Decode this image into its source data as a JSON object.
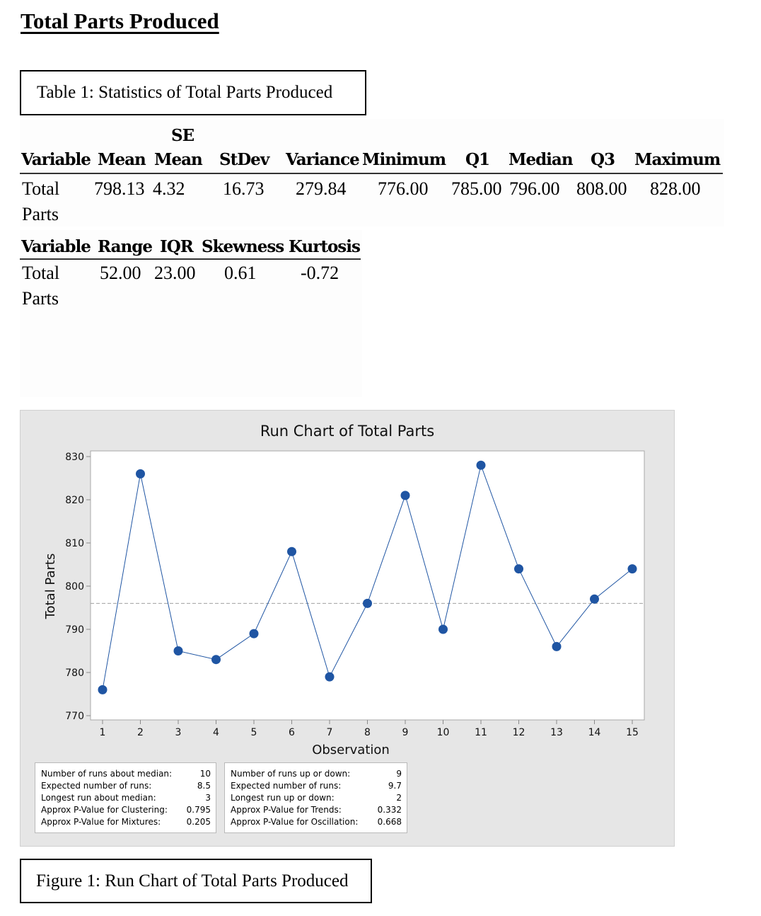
{
  "document": {
    "title": "Total Parts Produced",
    "table_caption": "Table 1: Statistics of Total Parts Produced",
    "figure_caption": "Figure 1: Run Chart of Total Parts Produced"
  },
  "stats_table_1": {
    "headers": [
      "Variable",
      "Mean",
      "SE Mean",
      "StDev",
      "Variance",
      "Minimum",
      "Q1",
      "Median",
      "Q3",
      "Maximum"
    ],
    "header_se_top": "SE",
    "header_se_bottom": "Mean",
    "row": {
      "variable_line1": "Total",
      "variable_line2": "Parts",
      "values": [
        "798.13",
        "4.32",
        "16.73",
        "279.84",
        "776.00",
        "785.00",
        "796.00",
        "808.00",
        "828.00"
      ]
    }
  },
  "stats_table_2": {
    "headers": [
      "Variable",
      "Range",
      "IQR",
      "Skewness",
      "Kurtosis"
    ],
    "row": {
      "variable_line1": "Total",
      "variable_line2": "Parts",
      "values": [
        "52.00",
        "23.00",
        "0.61",
        "-0.72"
      ]
    }
  },
  "chart_data": {
    "type": "line",
    "title": "Run Chart of Total Parts",
    "xlabel": "Observation",
    "ylabel": "Total Parts",
    "x": [
      1,
      2,
      3,
      4,
      5,
      6,
      7,
      8,
      9,
      10,
      11,
      12,
      13,
      14,
      15
    ],
    "values": [
      776,
      826,
      785,
      783,
      789,
      808,
      779,
      796,
      821,
      790,
      828,
      804,
      786,
      797,
      804
    ],
    "median_line": 796,
    "ylim": [
      770,
      830
    ],
    "xlim": [
      1,
      15
    ],
    "yticks": [
      770,
      780,
      790,
      800,
      810,
      820,
      830
    ],
    "xticks": [
      1,
      2,
      3,
      4,
      5,
      6,
      7,
      8,
      9,
      10,
      11,
      12,
      13,
      14,
      15
    ],
    "grid": false,
    "series_color": "#1f55a3",
    "median_line_color": "#a0a0a0",
    "runs_median": [
      {
        "label": "Number of runs about median:",
        "value": "10"
      },
      {
        "label": "Expected number of runs:",
        "value": "8.5"
      },
      {
        "label": "Longest run about median:",
        "value": "3"
      },
      {
        "label": "Approx P-Value for Clustering:",
        "value": "0.795"
      },
      {
        "label": "Approx P-Value for Mixtures:",
        "value": "0.205"
      }
    ],
    "runs_updown": [
      {
        "label": "Number of runs up or down:",
        "value": "9"
      },
      {
        "label": "Expected number of runs:",
        "value": "9.7"
      },
      {
        "label": "Longest run up or down:",
        "value": "2"
      },
      {
        "label": "Approx P-Value for Trends:",
        "value": "0.332"
      },
      {
        "label": "Approx P-Value for Oscillation:",
        "value": "0.668"
      }
    ]
  }
}
